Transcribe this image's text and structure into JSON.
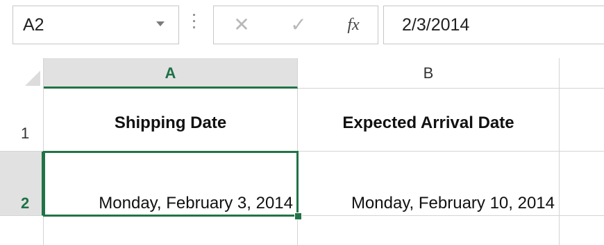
{
  "formula_bar": {
    "name_box": "A2",
    "cancel_icon": "close-x-icon",
    "enter_icon": "checkmark-icon",
    "fx_label": "fx",
    "formula_value": "2/3/2014"
  },
  "grid": {
    "columns": [
      "A",
      "B"
    ],
    "rows": [
      "1",
      "2"
    ],
    "cells": {
      "A1": "Shipping Date",
      "B1": "Expected Arrival Date",
      "A2": "Monday, February 3, 2014",
      "B2": "Monday, February 10, 2014"
    },
    "selected_cell": "A2"
  },
  "colors": {
    "accent": "#217346",
    "header_selected_bg": "#e1e1e1",
    "gridline": "#d4d4d4"
  }
}
